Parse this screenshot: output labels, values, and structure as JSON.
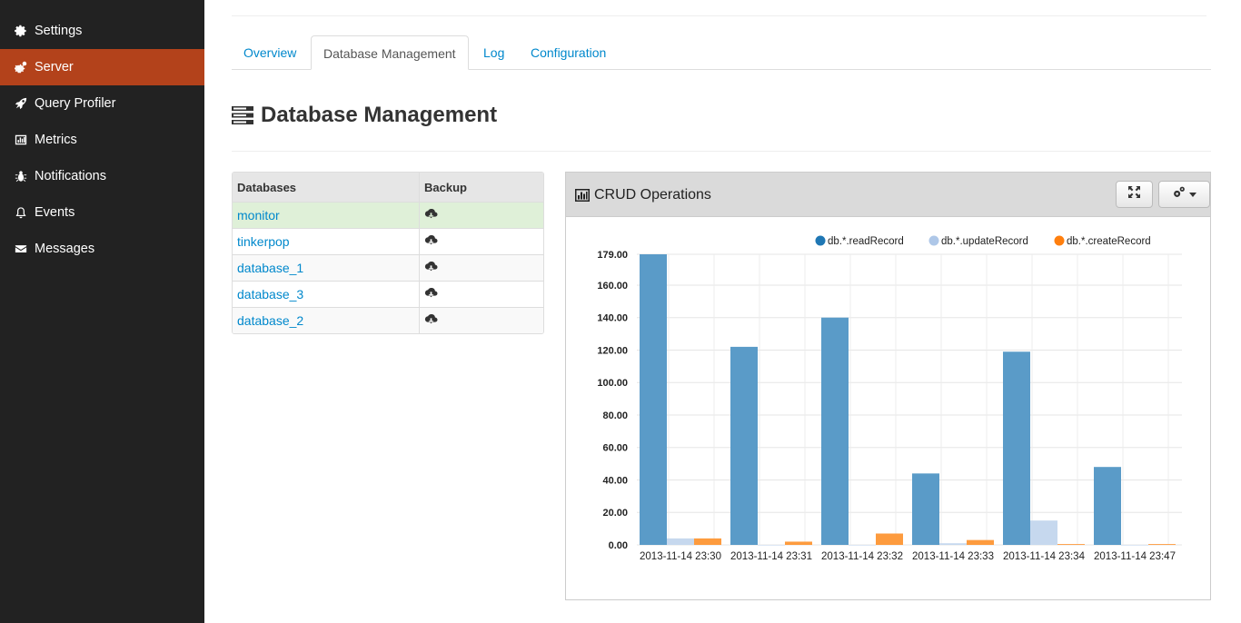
{
  "sidebar": {
    "items": [
      {
        "label": "Settings",
        "icon": "gear-icon",
        "active": false
      },
      {
        "label": "Server",
        "icon": "gears-icon",
        "active": true
      },
      {
        "label": "Query Profiler",
        "icon": "rocket-icon",
        "active": false
      },
      {
        "label": "Metrics",
        "icon": "bar-chart-icon",
        "active": false
      },
      {
        "label": "Notifications",
        "icon": "bug-icon",
        "active": false
      },
      {
        "label": "Events",
        "icon": "bell-icon",
        "active": false
      },
      {
        "label": "Messages",
        "icon": "envelope-icon",
        "active": false
      }
    ],
    "active_color": "#b3421b"
  },
  "tabs": [
    {
      "label": "Overview",
      "active": false
    },
    {
      "label": "Database Management",
      "active": true
    },
    {
      "label": "Log",
      "active": false
    },
    {
      "label": "Configuration",
      "active": false
    }
  ],
  "page": {
    "title": "Database Management",
    "title_icon": "server-stack-icon"
  },
  "databases": {
    "headers": {
      "name": "Databases",
      "backup": "Backup"
    },
    "backup_icon": "cloud-download-icon",
    "rows": [
      {
        "name": "monitor",
        "highlight": true
      },
      {
        "name": "tinkerpop",
        "highlight": false
      },
      {
        "name": "database_1",
        "highlight": false
      },
      {
        "name": "database_3",
        "highlight": false
      },
      {
        "name": "database_2",
        "highlight": false
      }
    ]
  },
  "panel": {
    "title": "CRUD Operations",
    "title_icon": "bar-chart-icon",
    "fullscreen_icon": "expand-icon",
    "settings_icon": "gears-icon",
    "settings_caret_icon": "caret-down-icon"
  },
  "chart_data": {
    "type": "bar",
    "categories": [
      "2013-11-14 23:30",
      "2013-11-14 23:31",
      "2013-11-14 23:32",
      "2013-11-14 23:33",
      "2013-11-14 23:34",
      "2013-11-14 23:47"
    ],
    "series": [
      {
        "name": "db.*.readRecord",
        "color": "#5a9bc8",
        "legend_color": "#1f77b4",
        "values": [
          179,
          122,
          140,
          44,
          119,
          48
        ]
      },
      {
        "name": "db.*.updateRecord",
        "color": "#c6d8ee",
        "legend_color": "#aec7e8",
        "values": [
          4,
          0,
          0,
          1,
          15,
          0
        ]
      },
      {
        "name": "db.*.createRecord",
        "color": "#fd9b3e",
        "legend_color": "#ff7f0e",
        "values": [
          4,
          2,
          7,
          3,
          0.5,
          0.5
        ]
      }
    ],
    "ylim": [
      0,
      179
    ],
    "yticks": [
      "0.00",
      "20.00",
      "40.00",
      "60.00",
      "80.00",
      "100.00",
      "120.00",
      "140.00",
      "160.00",
      "179.00"
    ],
    "ytick_values": [
      0,
      20,
      40,
      60,
      80,
      100,
      120,
      140,
      160,
      179
    ],
    "grid": true,
    "legend_position": "top-right"
  }
}
